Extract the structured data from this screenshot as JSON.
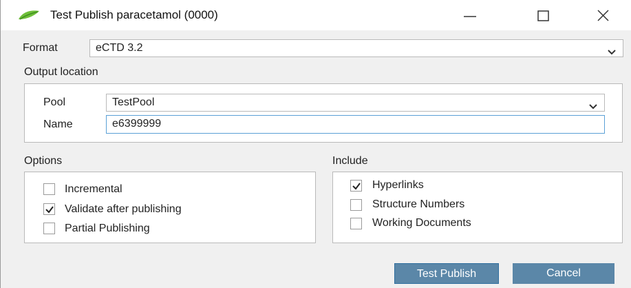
{
  "window": {
    "title": "Test Publish paracetamol (0000)",
    "icons": {
      "app": "green-leaf-icon",
      "minimize": "minimize-icon",
      "maximize": "maximize-icon",
      "close": "close-icon"
    }
  },
  "format": {
    "label": "Format",
    "value": "eCTD 3.2"
  },
  "output_location": {
    "label": "Output location",
    "pool": {
      "label": "Pool",
      "value": "TestPool"
    },
    "name": {
      "label": "Name",
      "value": "e6399999"
    }
  },
  "options": {
    "label": "Options",
    "items": [
      {
        "label": "Incremental",
        "checked": false
      },
      {
        "label": "Validate after publishing",
        "checked": true
      },
      {
        "label": "Partial Publishing",
        "checked": false
      }
    ]
  },
  "include": {
    "label": "Include",
    "items": [
      {
        "label": "Hyperlinks",
        "checked": true
      },
      {
        "label": "Structure Numbers",
        "checked": false
      },
      {
        "label": "Working Documents",
        "checked": false
      }
    ]
  },
  "buttons": {
    "test_publish": "Test Publish",
    "cancel": "Cancel"
  },
  "colors": {
    "button_bg": "#5b87a8",
    "focus_border": "#5aa0d6",
    "window_bg": "#f0f0f0"
  }
}
